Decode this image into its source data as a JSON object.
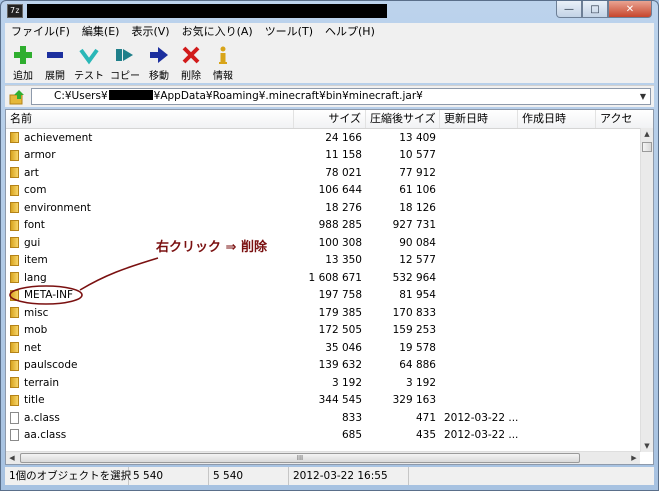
{
  "window": {
    "controls": {
      "minimize": "—",
      "maximize": "□",
      "close": "✕"
    }
  },
  "menubar": {
    "items": [
      "ファイル(F)",
      "編集(E)",
      "表示(V)",
      "お気に入り(A)",
      "ツール(T)",
      "ヘルプ(H)"
    ]
  },
  "toolbar": {
    "buttons": [
      {
        "label": "追加",
        "icon": "add-plus-icon",
        "color": "#2fae2f"
      },
      {
        "label": "展開",
        "icon": "extract-minus-icon",
        "color": "#1c2f9e"
      },
      {
        "label": "テスト",
        "icon": "test-check-icon",
        "color": "#2ab7b7"
      },
      {
        "label": "コピー",
        "icon": "copy-arrow-icon",
        "color": "#1f7f8a"
      },
      {
        "label": "移動",
        "icon": "move-arrow-icon",
        "color": "#1c2f9e"
      },
      {
        "label": "削除",
        "icon": "delete-x-icon",
        "color": "#d11b1b"
      },
      {
        "label": "情報",
        "icon": "info-icon",
        "color": "#d8a419"
      }
    ]
  },
  "address": {
    "prefix": "C:¥Users¥",
    "suffix": "¥AppData¥Roaming¥.minecraft¥bin¥minecraft.jar¥"
  },
  "list": {
    "headers": {
      "name": "名前",
      "size": "サイズ",
      "packed": "圧縮後サイズ",
      "modified": "更新日時",
      "created": "作成日時",
      "accessed": "アクセ"
    },
    "rows": [
      {
        "type": "folder",
        "name": "achievement",
        "size": "24 166",
        "packed": "13 409",
        "modified": ""
      },
      {
        "type": "folder",
        "name": "armor",
        "size": "11 158",
        "packed": "10 577",
        "modified": ""
      },
      {
        "type": "folder",
        "name": "art",
        "size": "78 021",
        "packed": "77 912",
        "modified": ""
      },
      {
        "type": "folder",
        "name": "com",
        "size": "106 644",
        "packed": "61 106",
        "modified": ""
      },
      {
        "type": "folder",
        "name": "environment",
        "size": "18 276",
        "packed": "18 126",
        "modified": ""
      },
      {
        "type": "folder",
        "name": "font",
        "size": "988 285",
        "packed": "927 731",
        "modified": ""
      },
      {
        "type": "folder",
        "name": "gui",
        "size": "100 308",
        "packed": "90 084",
        "modified": ""
      },
      {
        "type": "folder",
        "name": "item",
        "size": "13 350",
        "packed": "12 577",
        "modified": ""
      },
      {
        "type": "folder",
        "name": "lang",
        "size": "1 608 671",
        "packed": "532 964",
        "modified": ""
      },
      {
        "type": "folder",
        "name": "META-INF",
        "size": "197 758",
        "packed": "81 954",
        "modified": ""
      },
      {
        "type": "folder",
        "name": "misc",
        "size": "179 385",
        "packed": "170 833",
        "modified": ""
      },
      {
        "type": "folder",
        "name": "mob",
        "size": "172 505",
        "packed": "159 253",
        "modified": ""
      },
      {
        "type": "folder",
        "name": "net",
        "size": "35 046",
        "packed": "19 578",
        "modified": ""
      },
      {
        "type": "folder",
        "name": "paulscode",
        "size": "139 632",
        "packed": "64 886",
        "modified": ""
      },
      {
        "type": "folder",
        "name": "terrain",
        "size": "3 192",
        "packed": "3 192",
        "modified": ""
      },
      {
        "type": "folder",
        "name": "title",
        "size": "344 545",
        "packed": "329 163",
        "modified": ""
      },
      {
        "type": "file",
        "name": "a.class",
        "size": "833",
        "packed": "471",
        "modified": "2012-03-22 ..."
      },
      {
        "type": "file",
        "name": "aa.class",
        "size": "685",
        "packed": "435",
        "modified": "2012-03-22 ..."
      }
    ]
  },
  "scroll": {
    "up": "▲",
    "down": "▼",
    "left": "◀",
    "right": "▶",
    "grip": "III"
  },
  "statusbar": {
    "selection": "1個のオブジェクトを選択",
    "size": "5 540",
    "packed": "5 540",
    "date": "2012-03-22 16:55"
  },
  "annotation": {
    "text": "右クリック ⇒ 削除",
    "color": "#7a1010"
  }
}
